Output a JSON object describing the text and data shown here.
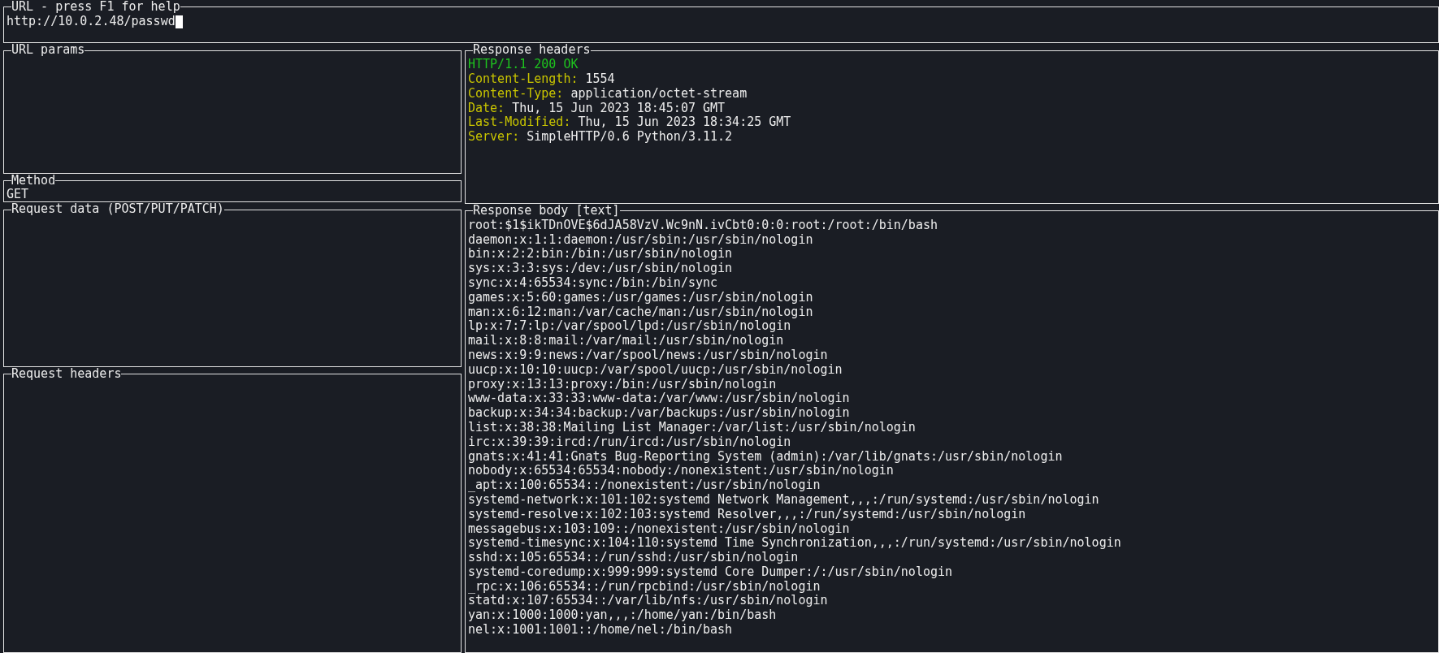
{
  "url_panel": {
    "title": "URL - press F1 for help",
    "value": "http://10.0.2.48/passwd"
  },
  "url_params": {
    "title": "URL params"
  },
  "method": {
    "title": "Method",
    "value": "GET"
  },
  "request_data": {
    "title": "Request data (POST/PUT/PATCH)"
  },
  "request_headers": {
    "title": "Request headers"
  },
  "response_headers": {
    "title": "Response headers",
    "status": "HTTP/1.1 200 OK",
    "headers": [
      {
        "name": "Content-Length:",
        "value": "1554"
      },
      {
        "name": "Content-Type:",
        "value": "application/octet-stream"
      },
      {
        "name": "Date:",
        "value": "Thu, 15 Jun 2023 18:45:07 GMT"
      },
      {
        "name": "Last-Modified:",
        "value": "Thu, 15 Jun 2023 18:34:25 GMT"
      },
      {
        "name": "Server:",
        "value": "SimpleHTTP/0.6 Python/3.11.2"
      }
    ]
  },
  "response_body": {
    "title": "Response body [text]",
    "lines": [
      "root:$1$ikTDnOVE$6dJA58VzV.Wc9nN.ivCbt0:0:0:root:/root:/bin/bash",
      "daemon:x:1:1:daemon:/usr/sbin:/usr/sbin/nologin",
      "bin:x:2:2:bin:/bin:/usr/sbin/nologin",
      "sys:x:3:3:sys:/dev:/usr/sbin/nologin",
      "sync:x:4:65534:sync:/bin:/bin/sync",
      "games:x:5:60:games:/usr/games:/usr/sbin/nologin",
      "man:x:6:12:man:/var/cache/man:/usr/sbin/nologin",
      "lp:x:7:7:lp:/var/spool/lpd:/usr/sbin/nologin",
      "mail:x:8:8:mail:/var/mail:/usr/sbin/nologin",
      "news:x:9:9:news:/var/spool/news:/usr/sbin/nologin",
      "uucp:x:10:10:uucp:/var/spool/uucp:/usr/sbin/nologin",
      "proxy:x:13:13:proxy:/bin:/usr/sbin/nologin",
      "www-data:x:33:33:www-data:/var/www:/usr/sbin/nologin",
      "backup:x:34:34:backup:/var/backups:/usr/sbin/nologin",
      "list:x:38:38:Mailing List Manager:/var/list:/usr/sbin/nologin",
      "irc:x:39:39:ircd:/run/ircd:/usr/sbin/nologin",
      "gnats:x:41:41:Gnats Bug-Reporting System (admin):/var/lib/gnats:/usr/sbin/nologin",
      "nobody:x:65534:65534:nobody:/nonexistent:/usr/sbin/nologin",
      "_apt:x:100:65534::/nonexistent:/usr/sbin/nologin",
      "systemd-network:x:101:102:systemd Network Management,,,:/run/systemd:/usr/sbin/nologin",
      "systemd-resolve:x:102:103:systemd Resolver,,,:/run/systemd:/usr/sbin/nologin",
      "messagebus:x:103:109::/nonexistent:/usr/sbin/nologin",
      "systemd-timesync:x:104:110:systemd Time Synchronization,,,:/run/systemd:/usr/sbin/nologin",
      "sshd:x:105:65534::/run/sshd:/usr/sbin/nologin",
      "systemd-coredump:x:999:999:systemd Core Dumper:/:/usr/sbin/nologin",
      "_rpc:x:106:65534::/run/rpcbind:/usr/sbin/nologin",
      "statd:x:107:65534::/var/lib/nfs:/usr/sbin/nologin",
      "yan:x:1000:1000:yan,,,:/home/yan:/bin/bash",
      "nel:x:1001:1001::/home/nel:/bin/bash"
    ]
  }
}
